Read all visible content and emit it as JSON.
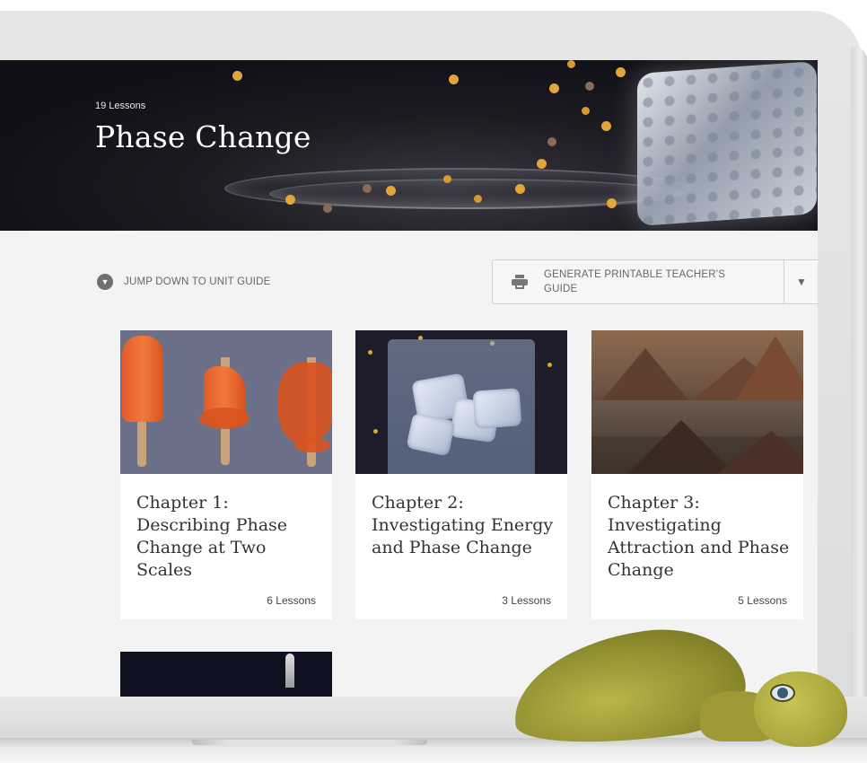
{
  "hero": {
    "lesson_count": "19 Lessons",
    "title": "Phase Change"
  },
  "actions": {
    "jump_label": "JUMP DOWN TO UNIT GUIDE",
    "guide_label": "GENERATE PRINTABLE TEACHER'S GUIDE"
  },
  "chapters": [
    {
      "title": "Chapter 1: Describing Phase Change at Two Scales",
      "count": "6 Lessons"
    },
    {
      "title": "Chapter 2: Investigating Energy and Phase Change",
      "count": "3 Lessons"
    },
    {
      "title": "Chapter 3: Investigating Attraction and Phase Change",
      "count": "5 Lessons"
    }
  ],
  "icons": {
    "jump": "chevron-down-circle-icon",
    "print": "printer-icon",
    "dropdown": "caret-down-icon"
  },
  "colors": {
    "hero_bg": "#14131b",
    "page_bg": "#f3f3f3",
    "accent_dot": "#e0a63a"
  }
}
